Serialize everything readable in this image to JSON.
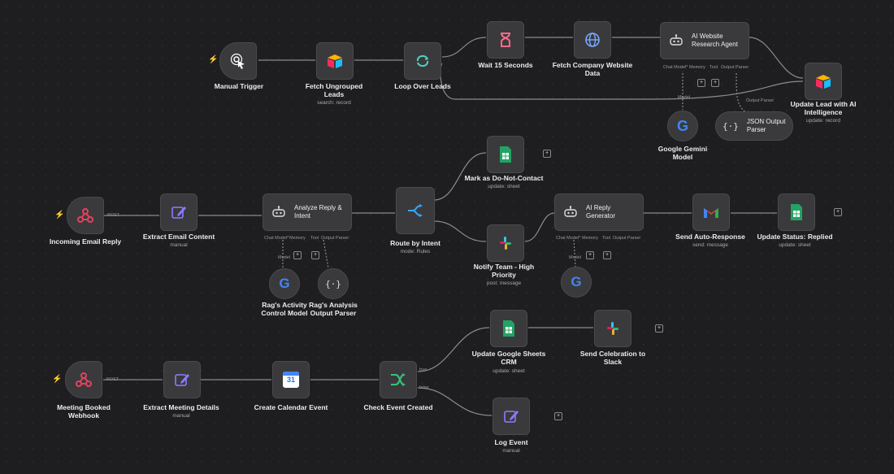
{
  "labels": {
    "manual_trigger": "Manual Trigger",
    "fetch_ungrouped": "Fetch Ungrouped\nLeads",
    "fetch_ungrouped_sub": "search: record",
    "loop_over": "Loop Over Leads",
    "wait": "Wait 15 Seconds",
    "fetch_website": "Fetch Company Website\nData",
    "ai_research": "AI Website\nResearch Agent",
    "update_lead": "Update Lead with AI\nIntelligence",
    "update_lead_sub": "update: record",
    "gemini": "Google Gemini\nModel",
    "json_parser": "JSON Output\nParser",
    "incoming_email": "Incoming Email Reply",
    "extract_email": "Extract Email Content",
    "extract_email_sub": "manual",
    "analyze_reply": "Analyze Reply &\nIntent",
    "route_intent": "Route by Intent",
    "route_intent_sub": "mode: Rules",
    "mark_dnc": "Mark as Do-Not-Contact",
    "mark_dnc_sub": "update: sheet",
    "notify_team": "Notify Team - High\nPriority",
    "notify_team_sub": "post: message",
    "ai_reply": "AI Reply\nGenerator",
    "send_auto": "Send Auto-Response",
    "send_auto_sub": "send: message",
    "update_status": "Update Status: Replied",
    "update_status_sub": "update: sheet",
    "rags_activity": "Rag's Activity\nControl Model",
    "rags_analysis": "Rag's Analysis\nOutput Parser",
    "meeting_booked": "Meeting Booked\nWebhook",
    "extract_meeting": "Extract Meeting Details",
    "extract_meeting_sub": "manual",
    "create_calendar": "Create Calendar Event",
    "check_event": "Check Event Created",
    "update_sheets_crm": "Update Google Sheets\nCRM",
    "update_sheets_crm_sub": "update: sheet",
    "send_celebration": "Send Celebration to\nSlack",
    "log_event": "Log Event",
    "log_event_sub": "manual"
  },
  "port_labels": {
    "post": "POST",
    "chat_model": "Chat Model*",
    "memory": "Memory",
    "tool": "Tool",
    "output_parser": "Output Parser",
    "model": "Model",
    "true": "true",
    "false": "false"
  },
  "colors": {
    "background": "#1e1e21",
    "node": "#3a3a3c",
    "edge": "#8b8b90",
    "trigger_bolt": "#ff6b4a",
    "webhook": "#e8405e",
    "airtable_yellow": "#fcb400",
    "airtable_blue": "#18bfff",
    "airtable_red": "#f82b60",
    "loop": "#4fd1c5",
    "wait": "#ff6b8b",
    "http": "#7aa7ff",
    "edit": "#8b7cff",
    "sheets": "#21a464",
    "switch": "#35a7ff",
    "if_green": "#36c47a",
    "gmail_red": "#ea4335"
  },
  "icons": {
    "manual_trigger": "pointer-click-icon",
    "airtable": "airtable-icon",
    "loop": "loop-icon",
    "wait": "hourglass-icon",
    "http": "globe-icon",
    "agent": "robot-icon",
    "google": "google-g-icon",
    "json": "braces-icon",
    "webhook": "webhook-icon",
    "edit": "pencil-edit-icon",
    "switch": "route-switch-icon",
    "sheets": "google-sheets-icon",
    "slack": "slack-icon",
    "gmail": "gmail-icon",
    "calendar": "google-calendar-icon",
    "if": "if-branch-icon"
  },
  "calendar_day": "31"
}
